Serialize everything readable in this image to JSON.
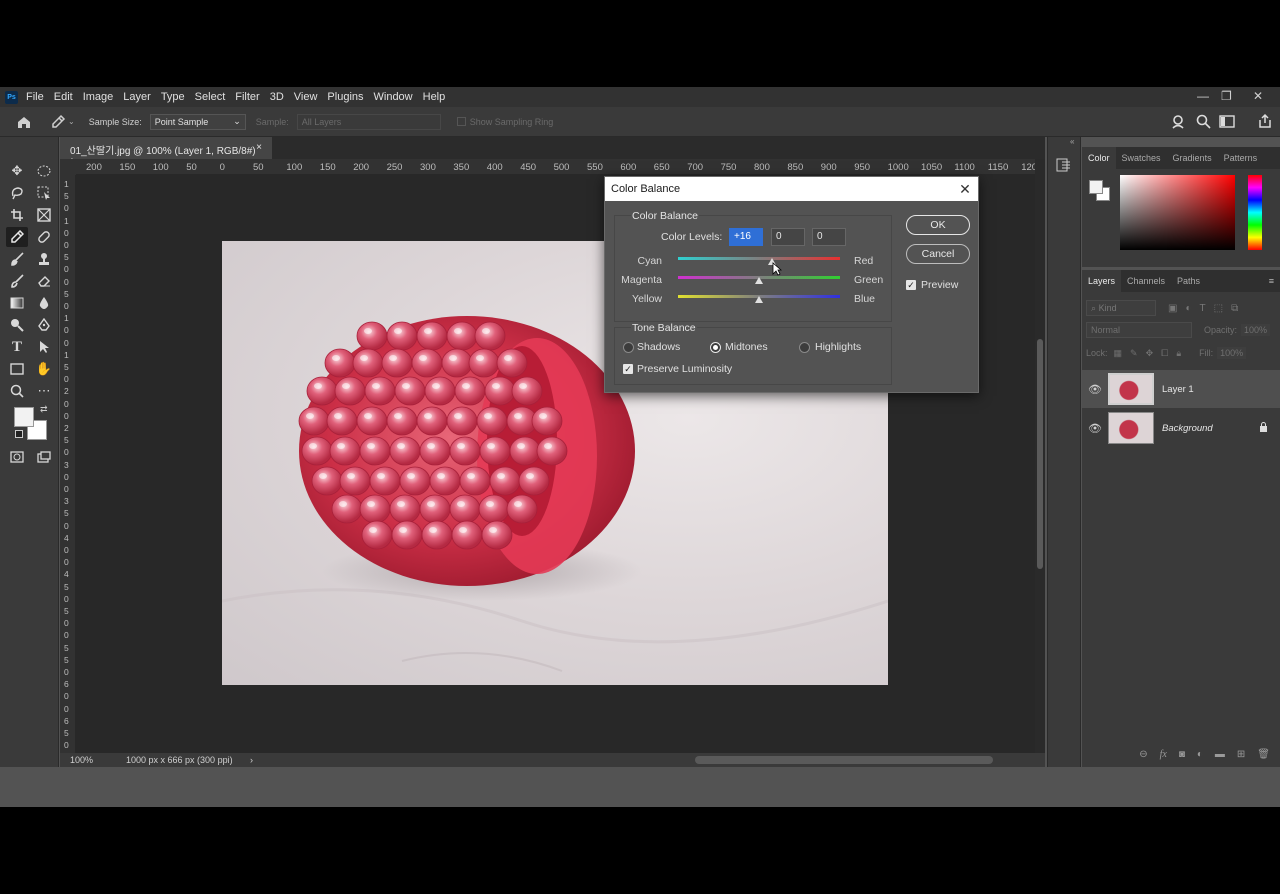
{
  "app": {
    "logo": "Ps",
    "menu": [
      "File",
      "Edit",
      "Image",
      "Layer",
      "Type",
      "Select",
      "Filter",
      "3D",
      "View",
      "Plugins",
      "Window",
      "Help"
    ],
    "window_controls": {
      "minimize": "—",
      "restore": "❐",
      "close": "✕"
    }
  },
  "options_bar": {
    "sample_size_label": "Sample Size:",
    "sample_size_value": "Point Sample",
    "sample_label": "Sample:",
    "sample_value": "All Layers",
    "sampling_ring_label": "Show Sampling Ring"
  },
  "document": {
    "tab_title": "01_산딸기.jpg @ 100% (Layer 1, RGB/8#) *",
    "tab_close": "×",
    "ruler_h": [
      "200",
      "150",
      "100",
      "50",
      "0",
      "50",
      "100",
      "150",
      "200",
      "250",
      "300",
      "350",
      "400",
      "450",
      "500",
      "550",
      "600",
      "650",
      "700",
      "750",
      "800",
      "850",
      "900",
      "950",
      "1000",
      "1050",
      "1100",
      "1150",
      "120"
    ],
    "ruler_v": [
      "1",
      "5",
      "0",
      "1",
      "0",
      "0",
      "5",
      "0",
      "0",
      "5",
      "0",
      "1",
      "0",
      "0",
      "1",
      "5",
      "0",
      "2",
      "0",
      "0",
      "2",
      "5",
      "0",
      "3",
      "0",
      "0",
      "3",
      "5",
      "0",
      "4",
      "0",
      "0",
      "4",
      "5",
      "0",
      "5",
      "0",
      "0",
      "5",
      "5",
      "0",
      "6",
      "0",
      "0",
      "6",
      "5",
      "0"
    ],
    "zoom": "100%",
    "doc_info": "1000 px x 666 px (300 ppi)",
    "status_arrow": "›"
  },
  "color_panel": {
    "tabs": [
      "Color",
      "Swatches",
      "Gradients",
      "Patterns"
    ]
  },
  "layers_panel": {
    "tabs": [
      "Layers",
      "Channels",
      "Paths"
    ],
    "kind_placeholder": "Kind",
    "blend_mode": "Normal",
    "opacity_label": "Opacity:",
    "opacity_value": "100%",
    "lock_label": "Lock:",
    "fill_label": "Fill:",
    "fill_value": "100%",
    "layers": [
      {
        "name": "Layer 1"
      },
      {
        "name": "Background"
      }
    ]
  },
  "dialog": {
    "title": "Color Balance",
    "close": "✕",
    "color_balance_group": "Color Balance",
    "color_levels_label": "Color Levels:",
    "levels": [
      "+16",
      "0",
      "0"
    ],
    "sliders": [
      {
        "left": "Cyan",
        "right": "Red",
        "value": 16
      },
      {
        "left": "Magenta",
        "right": "Green",
        "value": 0
      },
      {
        "left": "Yellow",
        "right": "Blue",
        "value": 0
      }
    ],
    "tone_balance_group": "Tone Balance",
    "tones": [
      "Shadows",
      "Midtones",
      "Highlights"
    ],
    "selected_tone": "Midtones",
    "preserve_luminosity": "Preserve Luminosity",
    "ok": "OK",
    "cancel": "Cancel",
    "preview": "Preview"
  },
  "colors": {
    "accent_blue": "#1473e6",
    "selected_field": "#1e62c8"
  }
}
